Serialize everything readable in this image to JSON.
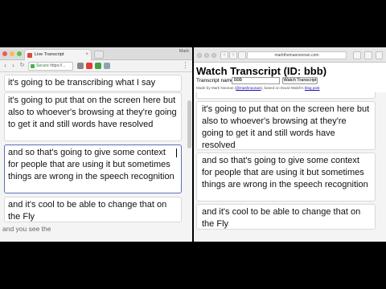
{
  "left_window": {
    "tab_title": "Live Transcript",
    "user_label": "Mark",
    "url_secure": "Secure",
    "url_rest": "https://...",
    "transcript": [
      "it's going to be transcribing what I say",
      "it's going to put that on the screen here but also to whoever's browsing at they're going to get it and still words have resolved",
      "and so that's going to give some context for people that are using it but sometimes things are wrong in the speech recognition",
      "and it's cool to be able to change that on the Fly"
    ],
    "typing_text": "and you see the"
  },
  "right_window": {
    "url": "markthomasnoonan.com",
    "page_title": "Watch Transcript (ID: bbb)",
    "name_label": "Transcript name:",
    "name_value": "bbb",
    "watch_button": "Watch Transcript",
    "credit_prefix": "Made by Mark Noonan",
    "credit_handle": "@mashnoonan",
    "credit_mid": ", based on David Walsh's",
    "credit_link": "blog post",
    "transcript": [
      "it's going to put that on the screen here but also to whoever's browsing at they're going to get it and still words have resolved",
      "and so that's going to give some context for people that are using it but sometimes things are wrong in the speech recognition",
      "and it's cool to be able to change that on the Fly"
    ]
  },
  "icons": {
    "favicon": "favicon-icon",
    "lock": "lock-icon",
    "extensions": [
      "extension-icon",
      "shield-icon",
      "tag-icon"
    ]
  }
}
